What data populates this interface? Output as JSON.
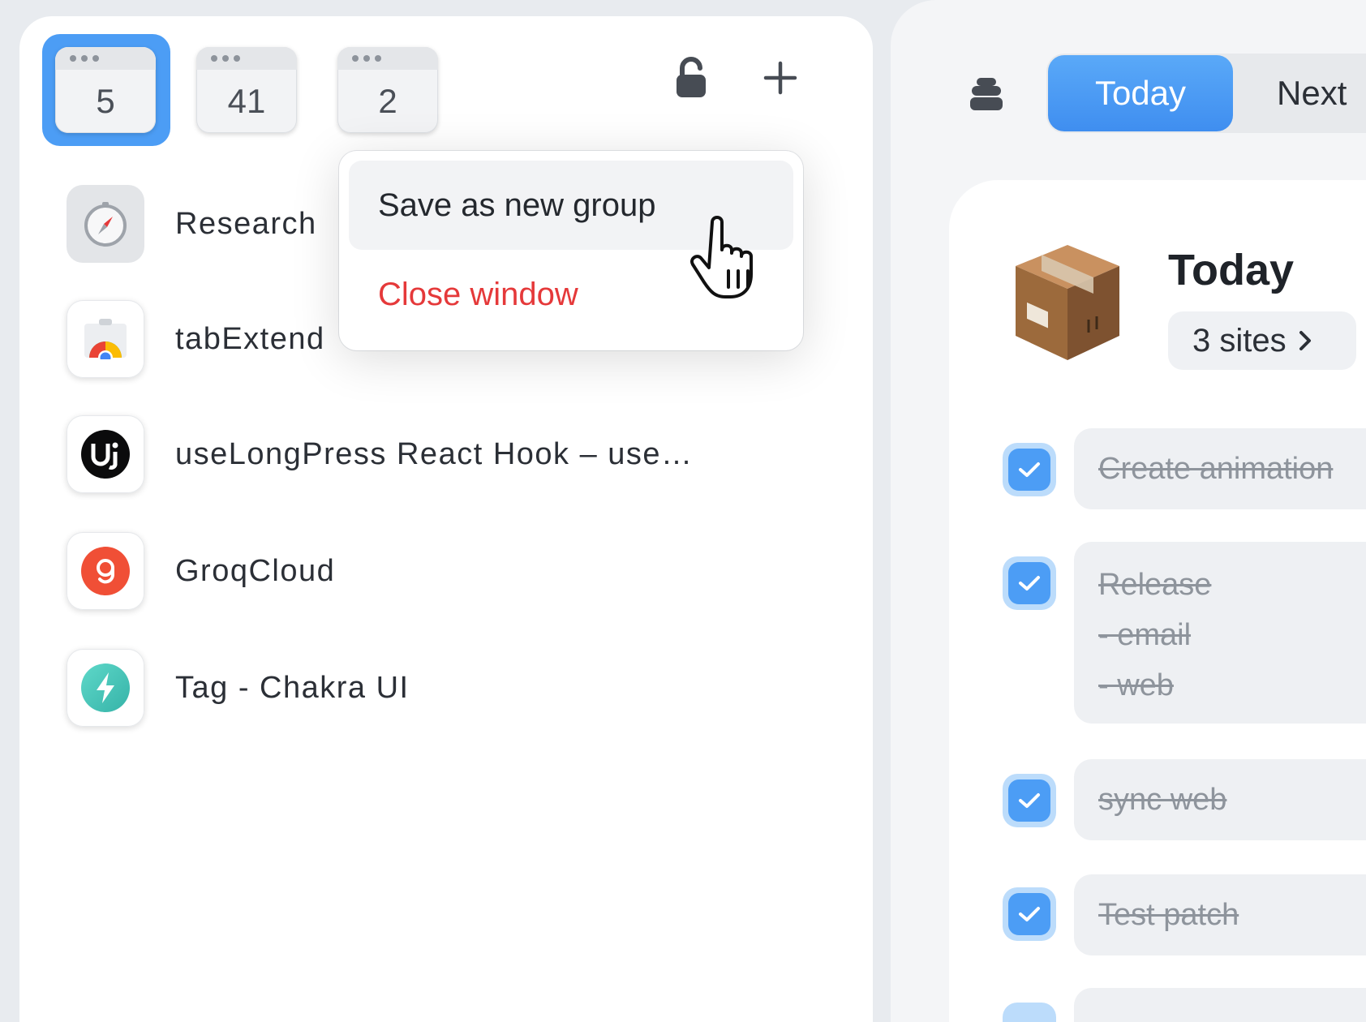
{
  "windows": [
    {
      "count": "5",
      "selected": true
    },
    {
      "count": "41",
      "selected": false
    },
    {
      "count": "2",
      "selected": false
    }
  ],
  "tabs": [
    {
      "title": "Research",
      "icon": "safari-compass-icon"
    },
    {
      "title": "tabExtend",
      "icon": "chrome-web-store-icon"
    },
    {
      "title": "useLongPress React Hook – use…",
      "icon": "usehooks-logo-icon"
    },
    {
      "title": "GroqCloud",
      "icon": "groq-logo-icon"
    },
    {
      "title": "Tag - Chakra UI",
      "icon": "chakra-ui-logo-icon"
    }
  ],
  "menu": {
    "save_group": "Save as new group",
    "close_window": "Close window"
  },
  "right": {
    "seg_today": "Today",
    "seg_next": "Next",
    "list_title": "Today",
    "sites_label": "3 sites",
    "tasks": [
      {
        "lines": [
          "Create animation"
        ],
        "done": true
      },
      {
        "lines": [
          "Release",
          "- email",
          "- web"
        ],
        "done": true
      },
      {
        "lines": [
          "sync web"
        ],
        "done": true
      },
      {
        "lines": [
          "Test patch"
        ],
        "done": true
      }
    ]
  },
  "colors": {
    "accent": "#4c9df5",
    "danger": "#e5393a"
  }
}
